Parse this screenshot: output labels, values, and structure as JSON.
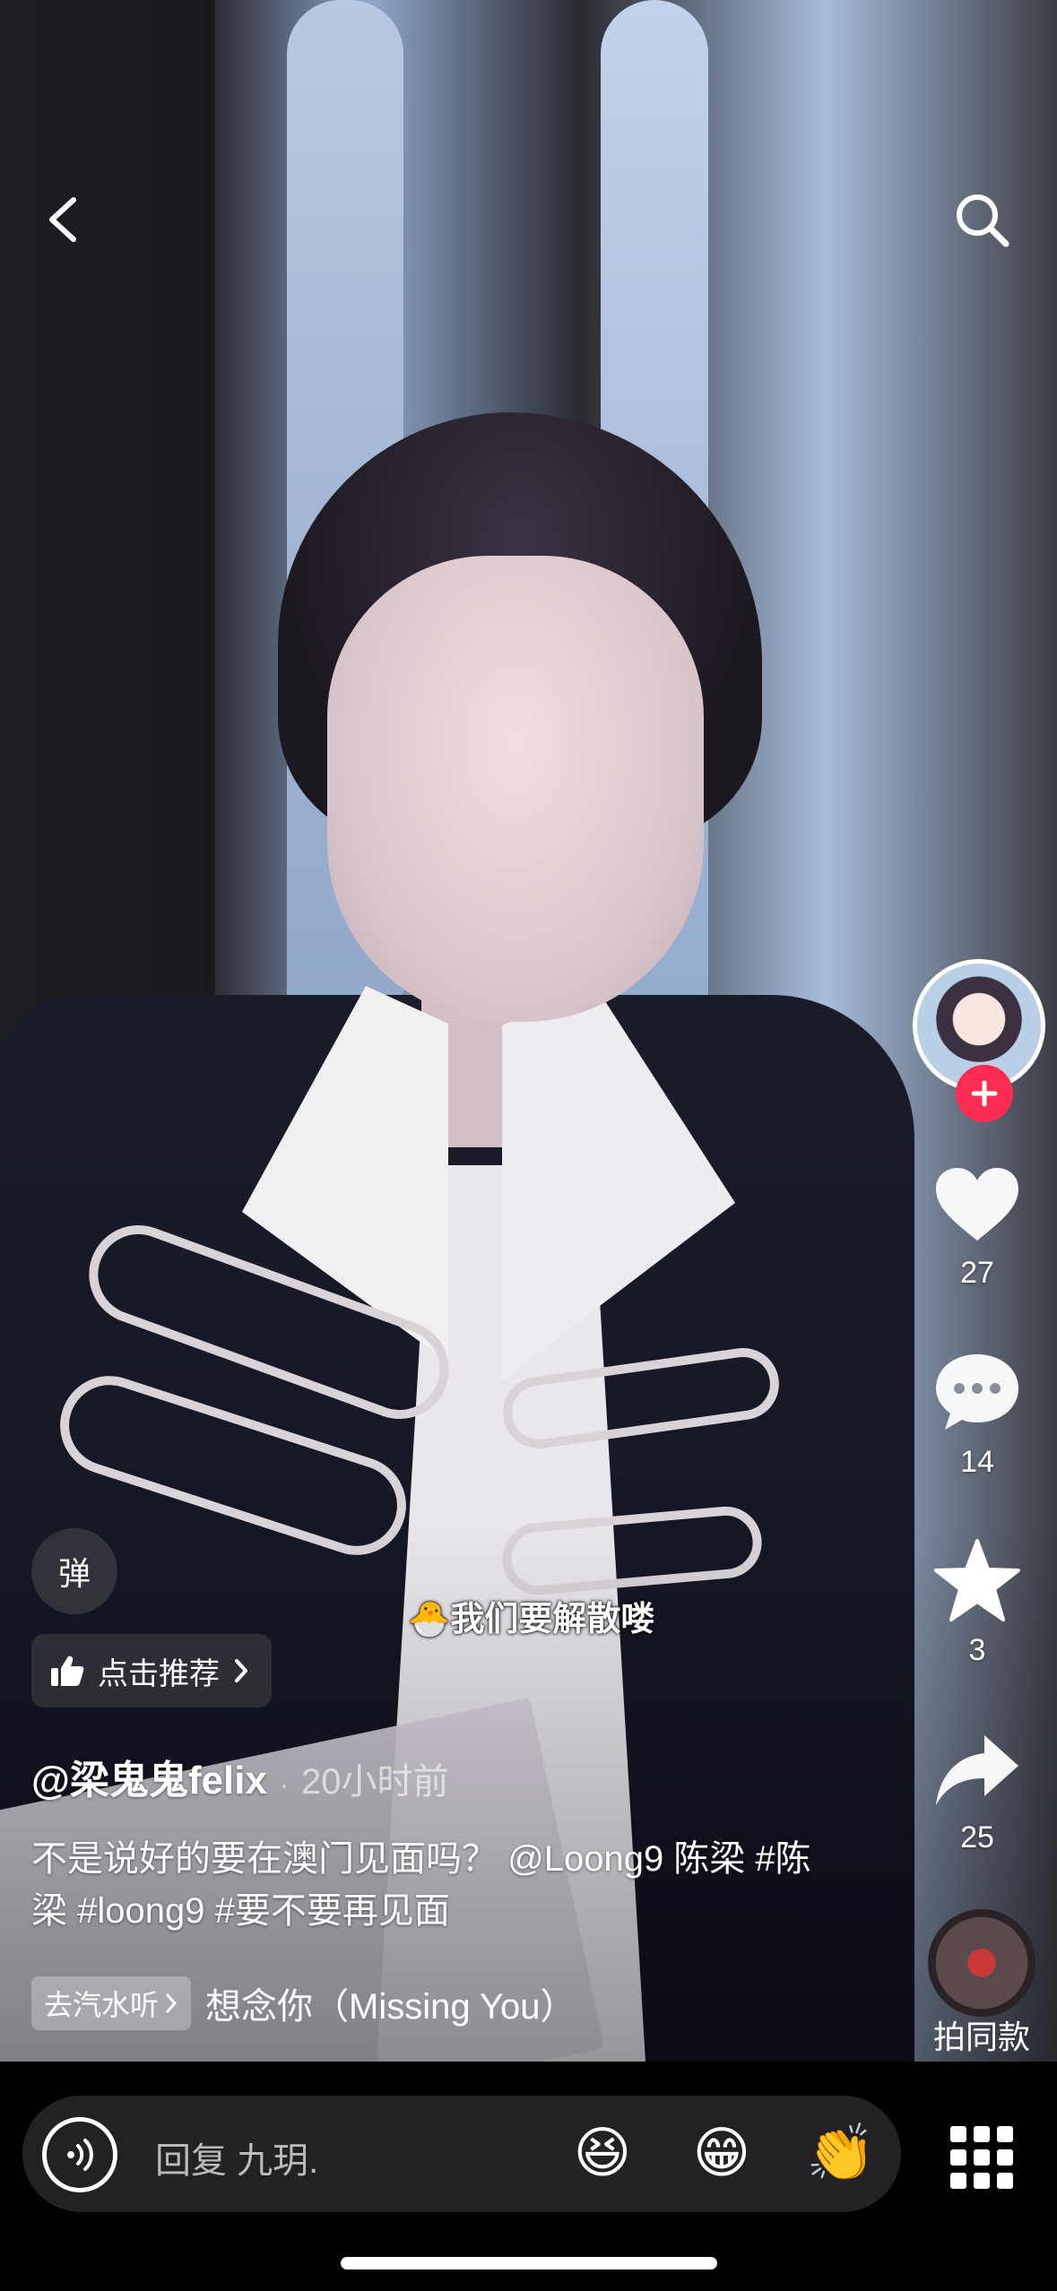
{
  "nav": {
    "back_icon": "chevron-left-icon",
    "search_icon": "search-icon"
  },
  "rail": {
    "follow_icon": "plus-icon",
    "likes": "27",
    "comments": "14",
    "favorites": "3",
    "shares": "25",
    "same_style_label": "拍同款"
  },
  "overlay": {
    "danmu_label": "弹",
    "recommend_label": "点击推荐",
    "sticker_text": "🐣我们要解散喽"
  },
  "post": {
    "author": "@梁鬼鬼felix",
    "separator": "·",
    "time": "20小时前",
    "description": "不是说好的要在澳门见面吗？ @Loong9 陈梁 #陈梁 #loong9 #要不要再见面",
    "music_tag": "去汽水听",
    "music_title": "想念你（Missing You）"
  },
  "bottom": {
    "reply_placeholder": "回复 九玥.",
    "emoji": [
      "😆",
      "😁",
      "👏"
    ]
  },
  "colors": {
    "follow": "#fe2c55",
    "background": "#000000"
  }
}
